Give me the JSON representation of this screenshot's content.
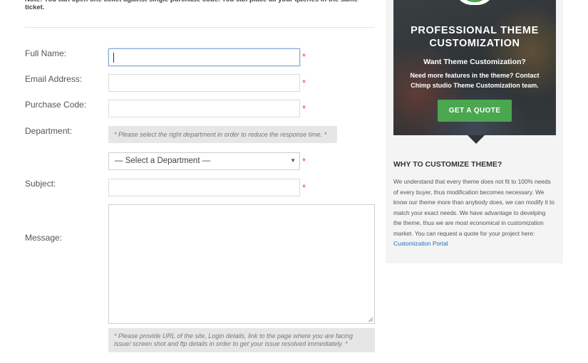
{
  "form": {
    "note": "Note: You can open one ticket against single purchase code. You can place all your queries in the same ticket.",
    "required_mark": "*",
    "labels": {
      "full_name": "Full Name:",
      "email": "Email Address:",
      "purchase_code": "Purchase Code:",
      "department": "Department:",
      "subject": "Subject:",
      "message": "Message:"
    },
    "values": {
      "full_name": "",
      "email": "",
      "purchase_code": "",
      "subject": "",
      "message": ""
    },
    "department_hint": "* Please select the right department in order to reduce the response time.",
    "department_select": {
      "selected": "— Select a Department —",
      "arrow": "▼"
    },
    "message_hint": "* Please provide URL of the site, Login details, link to the page where you are facing issue/ screen shot and ftp details in order to get your issue resolved immediately."
  },
  "sidebar": {
    "banner": {
      "title": "PROFESSIONAL THEME CUSTOMIZATION",
      "subtitle": "Want Theme Customization?",
      "description": "Need more features in the theme? Contact Chimp studio Theme Customization team.",
      "button_label": "GET A QUOTE",
      "icon": "pencil-icon"
    },
    "why_title": "WHY TO CUSTOMIZE THEME?",
    "why_text": "We understand that every theme does not fit to 100% needs of every buyer, thus modification becomes necessary. We know our theme more than anybody does, we can modify it to match your exact needs. We have advantage to develping the theme, thus we are most economical in customization market. You can request a quote for your project here:",
    "why_link": "Customization Portal"
  },
  "colors": {
    "required": "#e34a4a",
    "accent_green": "#4aa64f",
    "link": "#1e6fb7",
    "focus_border": "#7fa8d8"
  }
}
